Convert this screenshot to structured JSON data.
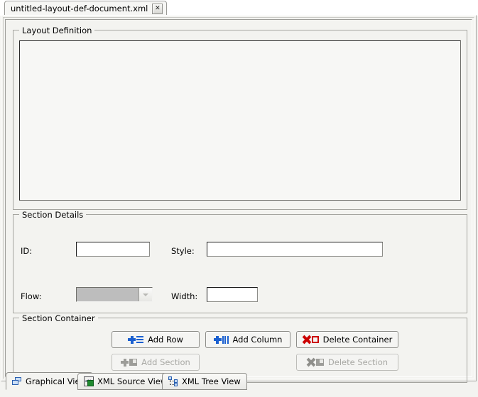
{
  "window": {
    "document_tab": {
      "label": "untitled-layout-def-document.xml",
      "close_icon": "close-icon",
      "close_glyph": "✕"
    }
  },
  "layout_definition": {
    "group_title": "Layout Definition",
    "canvas_content": ""
  },
  "section_details": {
    "group_title": "Section Details",
    "fields": {
      "id": {
        "label": "ID:",
        "value": "",
        "placeholder": ""
      },
      "style": {
        "label": "Style:",
        "value": "",
        "placeholder": ""
      },
      "flow": {
        "label": "Flow:",
        "selected": "",
        "enabled": false,
        "icon": "chevron-down-icon"
      },
      "width": {
        "label": "Width:",
        "value": "",
        "placeholder": ""
      }
    }
  },
  "section_container": {
    "group_title": "Section Container",
    "buttons": [
      {
        "label": "Add Row",
        "enabled": true,
        "icons": [
          "plus-icon",
          "rows-icon"
        ],
        "accent": "#1a5fd0"
      },
      {
        "label": "Add Column",
        "enabled": true,
        "icons": [
          "plus-icon",
          "columns-icon"
        ],
        "accent": "#1a5fd0"
      },
      {
        "label": "Delete Container",
        "enabled": true,
        "icons": [
          "x-mark-icon",
          "square-icon"
        ],
        "accent": "#cc0000"
      },
      {
        "label": "Add Section",
        "enabled": false,
        "icons": [
          "plus-icon",
          "section-icon"
        ],
        "accent": "#9d9d99"
      },
      {
        "label": "Delete Section",
        "enabled": false,
        "icons": [
          "x-mark-icon",
          "section-icon"
        ],
        "accent": "#8f8f8b"
      }
    ]
  },
  "view_tabs": [
    {
      "label": "Graphical View",
      "icon": "graphical-view-icon",
      "selected": true
    },
    {
      "label": "XML Source View",
      "icon": "xml-source-view-icon",
      "selected": false,
      "glyph": "<>"
    },
    {
      "label": "XML Tree View",
      "icon": "xml-tree-view-icon",
      "selected": false
    }
  ]
}
